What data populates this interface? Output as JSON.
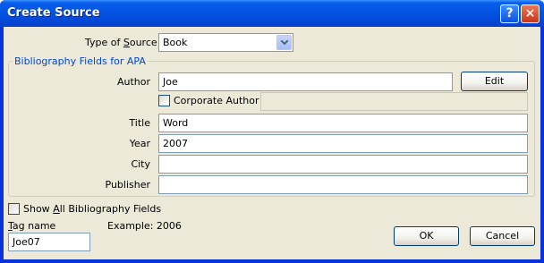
{
  "window": {
    "title": "Create Source",
    "help_symbol": "?",
    "close_symbol": "×"
  },
  "type_of_source": {
    "label_pre": "Type of ",
    "label_ul": "S",
    "label_post": "ource",
    "value": "Book"
  },
  "group_title": "Bibliography Fields for APA",
  "fields": {
    "author": {
      "label": "Author",
      "value": "Joe"
    },
    "corporate_author": {
      "label": "Corporate Author",
      "value": ""
    },
    "title": {
      "label": "Title",
      "value": "Word"
    },
    "year": {
      "label": "Year",
      "value": "2007"
    },
    "city": {
      "label": "City",
      "value": ""
    },
    "publisher": {
      "label": "Publisher",
      "value": ""
    }
  },
  "edit_button": "Edit",
  "show_all": {
    "pre": "Show ",
    "ul": "A",
    "post": "ll Bibliography Fields"
  },
  "tag": {
    "label_ul": "T",
    "label_post": "ag name",
    "value": "Joe07",
    "example": "Example: 2006"
  },
  "ok_button": "OK",
  "cancel_button": "Cancel",
  "colors": {
    "title_bar": "#0453e3",
    "dialog_bg": "#ece9d8",
    "group_title": "#0046d5"
  }
}
